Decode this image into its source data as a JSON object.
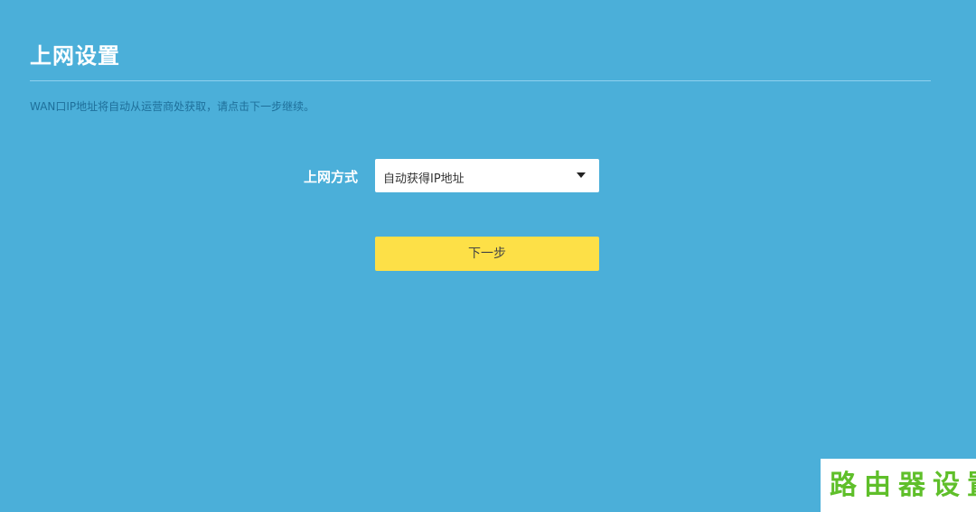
{
  "page": {
    "title": "上网设置",
    "hint": "WAN口IP地址将自动从运营商处获取，请点击下一步继续。"
  },
  "form": {
    "connection_label": "上网方式",
    "connection_type": {
      "selected": "自动获得IP地址"
    },
    "next_label": "下一步"
  },
  "watermark": {
    "text": "路由器设置"
  },
  "colors": {
    "background": "#4bafd9",
    "button_accent": "#fde047",
    "watermark_text": "#5fbf2a"
  },
  "icons": {
    "dropdown": "caret-down-icon"
  }
}
